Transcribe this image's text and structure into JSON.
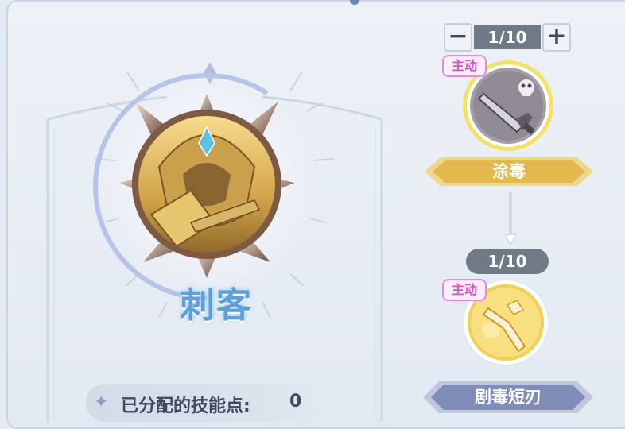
{
  "class_panel": {
    "class_name": "刺客",
    "points_label": "已分配的技能点:",
    "points_value": "0"
  },
  "skills": [
    {
      "badge": "主动",
      "level": "1/10",
      "name": "涂毒",
      "icon": "poison-dagger-icon",
      "minus_label": "−",
      "plus_label": "+"
    },
    {
      "badge": "主动",
      "level": "1/10",
      "name": "剧毒短刃",
      "icon": "gold-short-blade-icon"
    }
  ],
  "colors": {
    "class_name": "#5d9fdc",
    "gold_plate": "#e2b84f",
    "blue_plate": "#7f8db8",
    "badge_pink": "#d259c3",
    "level_bg": "#6f7a86"
  }
}
